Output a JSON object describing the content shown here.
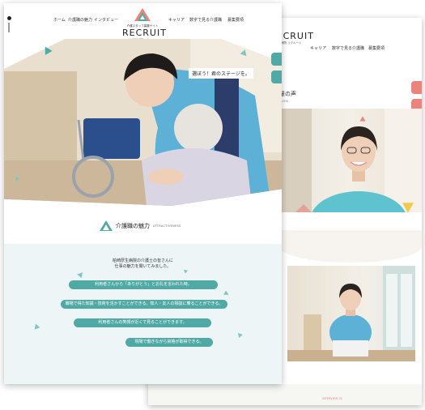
{
  "header": {
    "nav_left": [
      "ホーム",
      "介護職の魅力",
      "インタビュー"
    ],
    "nav_right": [
      "キャリア",
      "数字で見る介護職",
      "募集要項"
    ],
    "logo": {
      "subtitle": "介護スタッフ募集サイト",
      "title": "RECRUIT",
      "caption": "柏崎厚生病院 リクルート"
    }
  },
  "hero": {
    "tagline": "選ぼう！君のステージを。"
  },
  "section": {
    "title": "介護職の魅力",
    "title_en": "ATTRACTIVENESS"
  },
  "intro": {
    "line1": "柏崎厚生病院の介護士の皆さんに",
    "line2": "仕事の魅力を聞いてみました。"
  },
  "pills": [
    "利用者さんから「ありがとう」とお礼を言われた時。",
    "職場で得た知識・技術を活かすことができる。知人・友人の相談に乗ることができる。",
    "利用者さんの笑顔が近くで見ることができます。",
    "現場で働きながら資格が取得できる。"
  ],
  "back": {
    "nav": [
      "キャリア",
      "数字で見る介護職",
      "募集要項"
    ],
    "logo_title": "RECRUIT",
    "logo_caption": "柏崎厚生病院 リクルート",
    "section_title": "輩の声",
    "section_en": "RVIEW",
    "footer_label": "INTERVIEW 02"
  },
  "colors": {
    "accent": "#4fa9a5",
    "accent_light": "#7ec6c2",
    "coral": "#e9857c",
    "bg_pale": "#edf5f6"
  }
}
